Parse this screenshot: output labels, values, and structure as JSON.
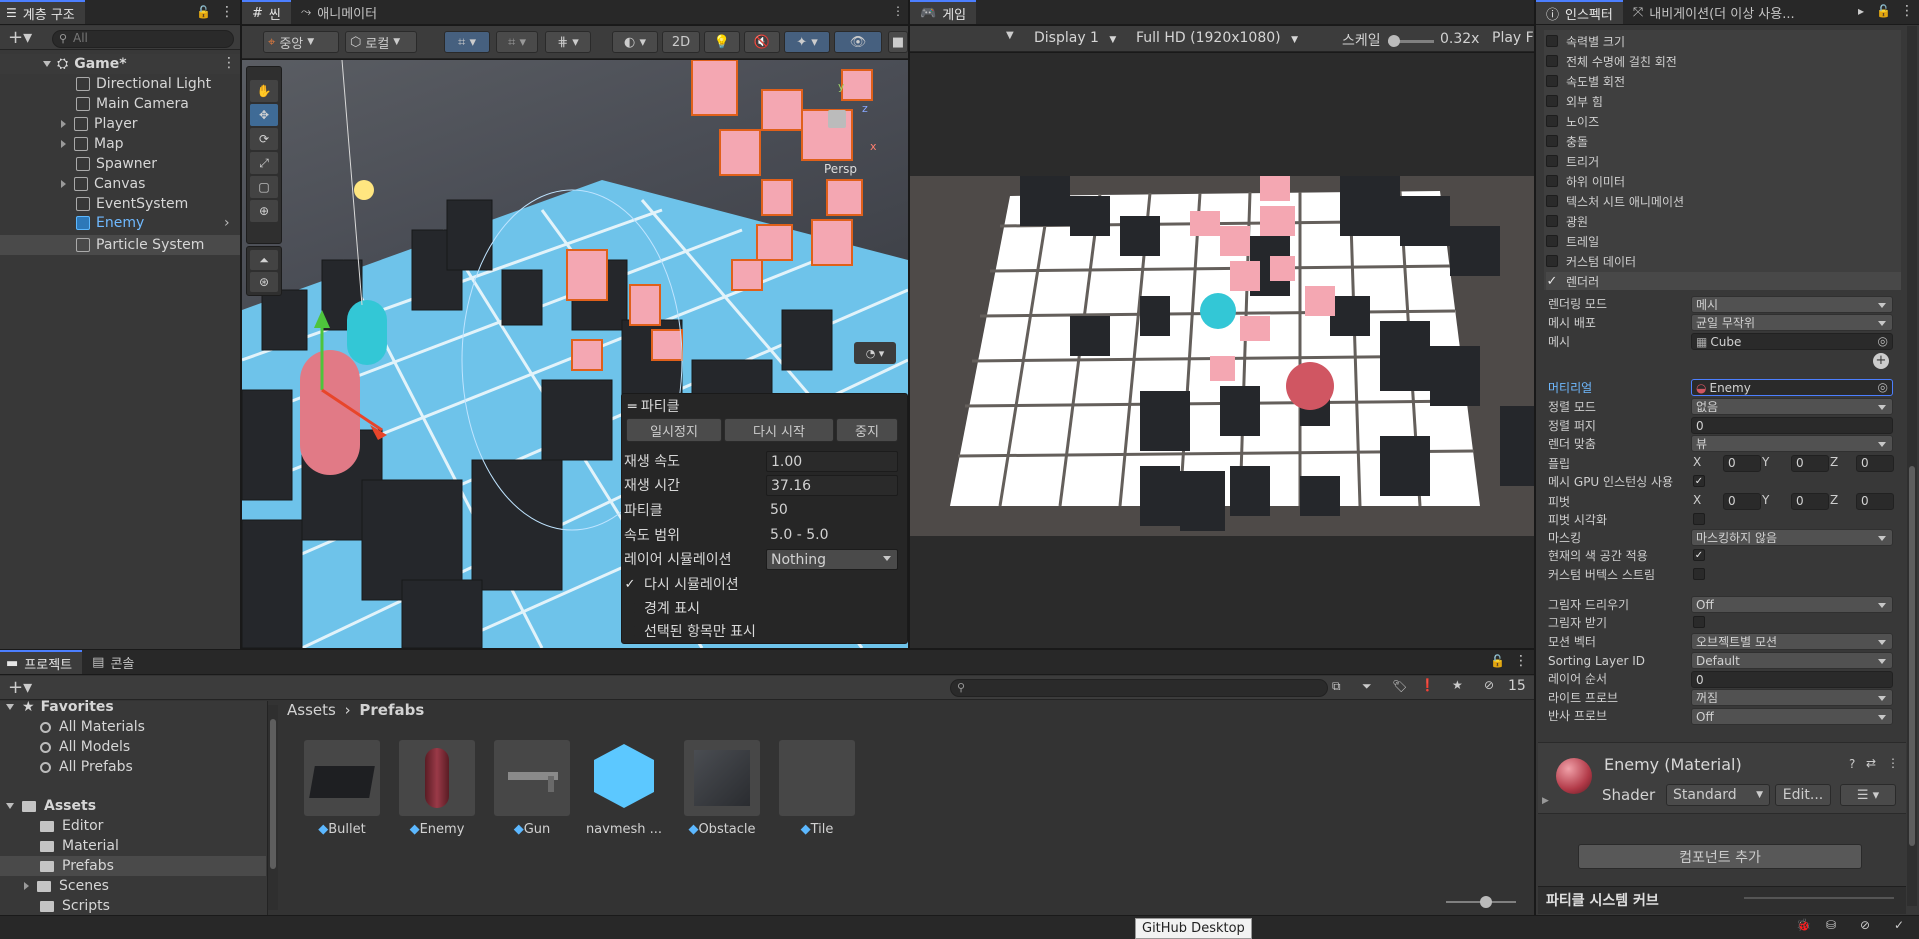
{
  "hierarchy": {
    "tab_label": "계층 구조",
    "search_placeholder": "All",
    "scene_name": "Game*",
    "items": [
      {
        "label": "Directional Light"
      },
      {
        "label": "Main Camera"
      },
      {
        "label": "Player"
      },
      {
        "label": "Map"
      },
      {
        "label": "Spawner"
      },
      {
        "label": "Canvas"
      },
      {
        "label": "EventSystem"
      },
      {
        "label": "Enemy"
      },
      {
        "label": "Particle System"
      }
    ]
  },
  "scene": {
    "tabs": [
      {
        "label": "씬"
      },
      {
        "label": "애니메이터"
      }
    ],
    "pivot_label": "중앙",
    "space_label": "로컬",
    "btn_2d": "2D",
    "persp_label": "Persp"
  },
  "particle_popup": {
    "title": "파티클",
    "pause": "일시정지",
    "restart": "다시 시작",
    "stop": "중지",
    "rows": [
      {
        "label": "재생 속도",
        "value": "1.00"
      },
      {
        "label": "재생 시간",
        "value": "37.16"
      },
      {
        "label": "파티클",
        "value": "50"
      },
      {
        "label": "속도 범위",
        "value": "5.0 - 5.0"
      }
    ],
    "layer_label": "레이어 시뮬레이션",
    "layer_value": "Nothing",
    "resimulate": "다시 시뮬레이션",
    "show_bounds": "경계 표시",
    "show_selected": "선택된 항목만 표시"
  },
  "game": {
    "tab_label": "게임",
    "display": "Display 1",
    "resolution": "Full HD (1920x1080)",
    "scale_label": "스케일",
    "scale_value": "0.32x",
    "play_label": "Play F"
  },
  "inspector": {
    "tabs": [
      {
        "label": "인스펙터"
      },
      {
        "label": "내비게이션(더 이상 사용..."
      }
    ],
    "modules": [
      {
        "label": "속력별 크기",
        "checked": false
      },
      {
        "label": "전체 수명에 걸친 회전",
        "checked": false
      },
      {
        "label": "속도별 회전",
        "checked": false
      },
      {
        "label": "외부 힘",
        "checked": false
      },
      {
        "label": "노이즈",
        "checked": false
      },
      {
        "label": "충돌",
        "checked": false
      },
      {
        "label": "트리거",
        "checked": false
      },
      {
        "label": "하위 이미터",
        "checked": false
      },
      {
        "label": "텍스처 시트 애니메이션",
        "checked": false
      },
      {
        "label": "광원",
        "checked": false
      },
      {
        "label": "트레일",
        "checked": false
      },
      {
        "label": "커스텀 데이터",
        "checked": false
      },
      {
        "label": "렌더러",
        "checked": true
      }
    ],
    "renderer": {
      "render_mode": {
        "label": "렌더링 모드",
        "value": "메시"
      },
      "mesh_dist": {
        "label": "메시 배포",
        "value": "균일 무작위"
      },
      "mesh": {
        "label": "메시",
        "value": "Cube"
      },
      "material": {
        "label": "머티리얼",
        "value": "Enemy"
      },
      "sort_mode": {
        "label": "정렬 모드",
        "value": "없음"
      },
      "sort_fudge": {
        "label": "정렬 퍼지",
        "value": "0"
      },
      "render_align": {
        "label": "렌더 맞춤",
        "value": "뷰"
      },
      "flip": {
        "label": "플립",
        "x": "0",
        "y": "0",
        "z": "0"
      },
      "gpu_instancing": {
        "label": "메시 GPU 인스턴싱 사용",
        "checked": true
      },
      "pivot": {
        "label": "피벗",
        "x": "0",
        "y": "0",
        "z": "0"
      },
      "visualize_pivot": {
        "label": "피벗 시각화",
        "checked": false
      },
      "masking": {
        "label": "마스킹",
        "value": "마스킹하지 않음"
      },
      "color_space": {
        "label": "현재의 색 공간 적용",
        "checked": true
      },
      "custom_vertex": {
        "label": "커스텀 버텍스 스트림",
        "checked": false
      },
      "cast_shadows": {
        "label": "그림자 드리우기",
        "value": "Off"
      },
      "receive_shadows": {
        "label": "그림자 받기",
        "checked": false
      },
      "motion_vectors": {
        "label": "모션 벡터",
        "value": "오브젝트별 모션"
      },
      "sorting_layer": {
        "label": "Sorting Layer ID",
        "value": "Default"
      },
      "order_in_layer": {
        "label": "레이어 순서",
        "value": "0"
      },
      "light_probes": {
        "label": "라이트 프로브",
        "value": "꺼짐"
      },
      "reflection_probes": {
        "label": "반사 프로브",
        "value": "Off"
      }
    },
    "material_header": {
      "title": "Enemy (Material)",
      "shader_label": "Shader",
      "shader_value": "Standard",
      "edit": "Edit..."
    },
    "add_component": "컴포넌트 추가",
    "curves_label": "파티클 시스템 커브"
  },
  "project": {
    "tabs": [
      {
        "label": "프로젝트"
      },
      {
        "label": "콘솔"
      }
    ],
    "favorites_label": "Favorites",
    "favorites": [
      {
        "label": "All Materials"
      },
      {
        "label": "All Models"
      },
      {
        "label": "All Prefabs"
      }
    ],
    "assets_label": "Assets",
    "folders": [
      {
        "label": "Editor"
      },
      {
        "label": "Material"
      },
      {
        "label": "Prefabs"
      },
      {
        "label": "Scenes"
      },
      {
        "label": "Scripts"
      }
    ],
    "breadcrumb": [
      {
        "label": "Assets"
      },
      {
        "label": "Prefabs"
      }
    ],
    "hidden_count": "15",
    "assets": [
      {
        "label": "Bullet"
      },
      {
        "label": "Enemy"
      },
      {
        "label": "Gun"
      },
      {
        "label": "navmesh ..."
      },
      {
        "label": "Obstacle"
      },
      {
        "label": "Tile"
      }
    ]
  },
  "tooltip": "GitHub Desktop"
}
